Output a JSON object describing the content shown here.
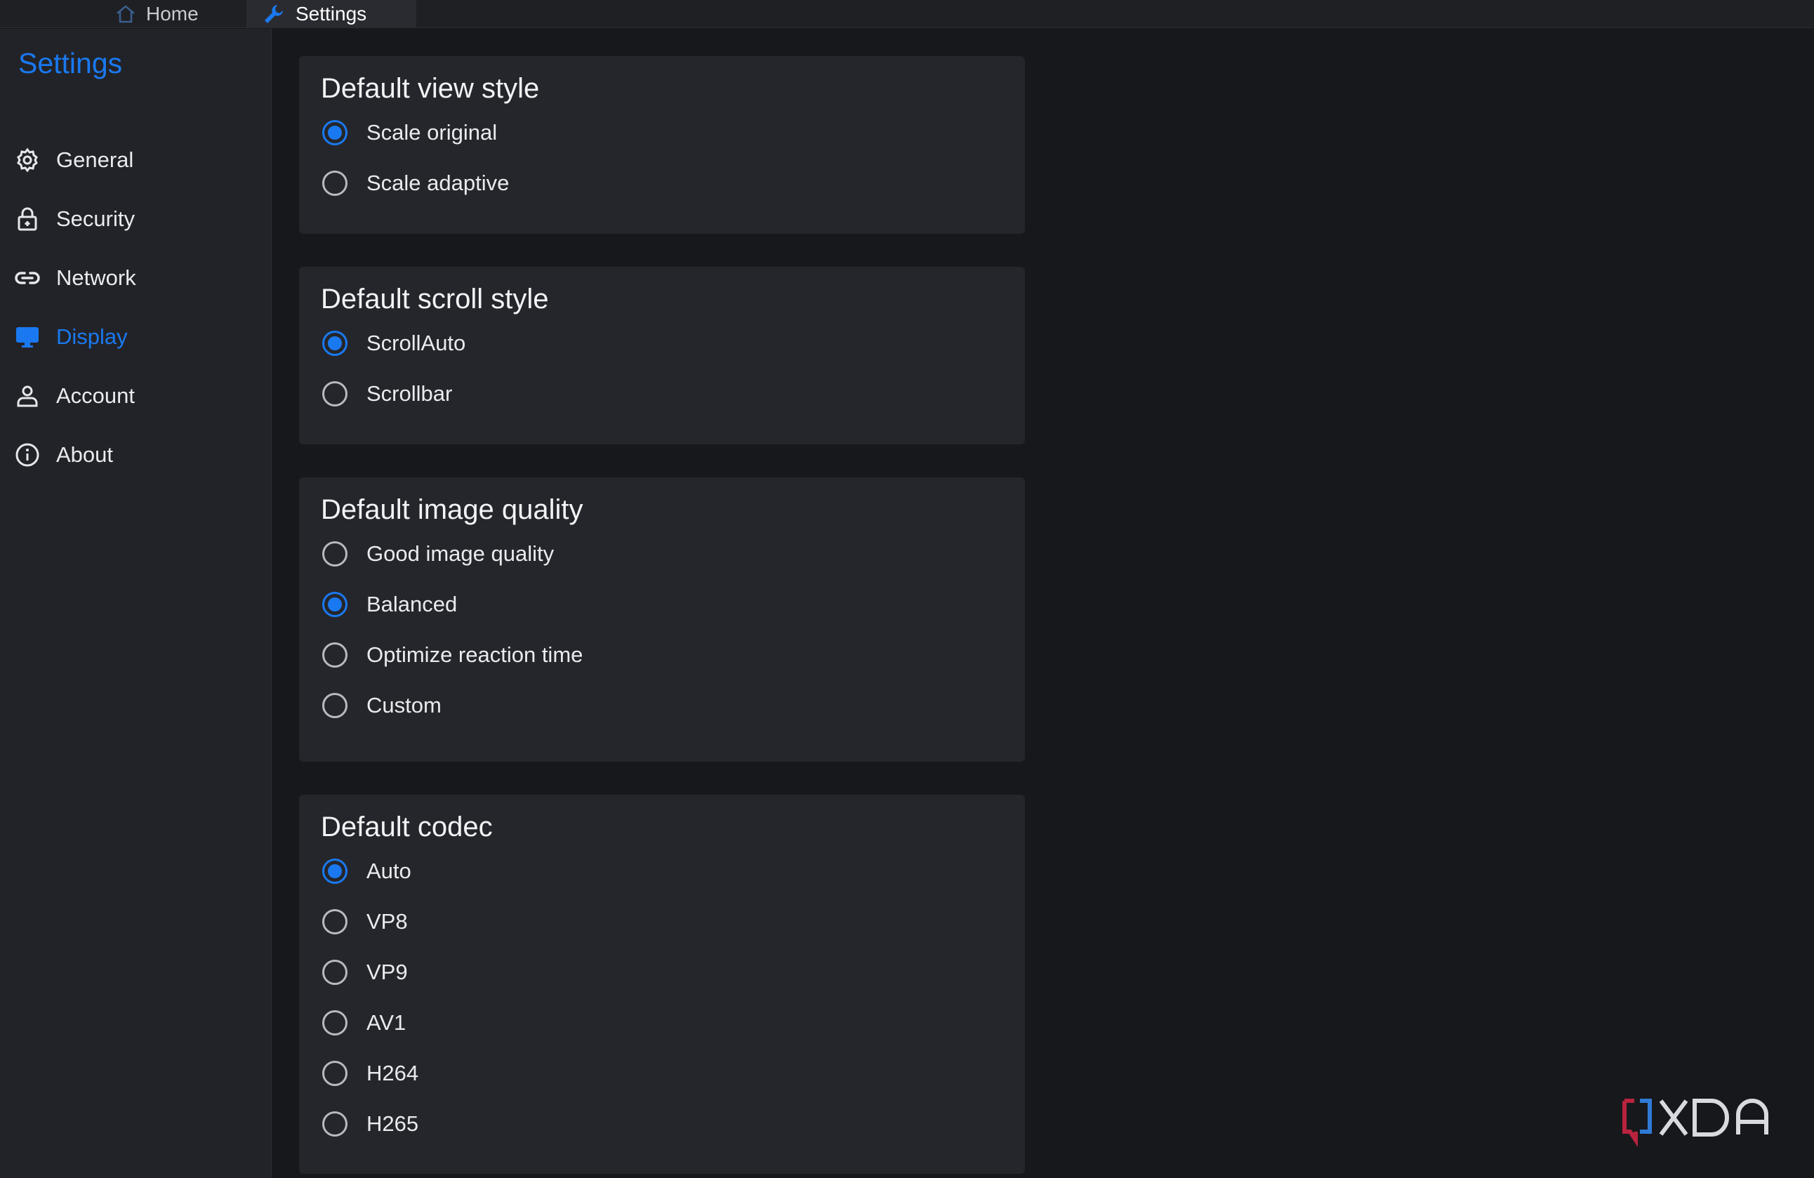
{
  "tabs": [
    {
      "label": "Home",
      "icon": "home-icon"
    },
    {
      "label": "Settings",
      "icon": "wrench-icon"
    }
  ],
  "sidebar": {
    "title": "Settings",
    "items": [
      {
        "label": "General",
        "icon": "gear-icon"
      },
      {
        "label": "Security",
        "icon": "lock-icon"
      },
      {
        "label": "Network",
        "icon": "link-icon"
      },
      {
        "label": "Display",
        "icon": "monitor-icon",
        "active": true
      },
      {
        "label": "Account",
        "icon": "user-icon"
      },
      {
        "label": "About",
        "icon": "info-icon"
      }
    ]
  },
  "sections": [
    {
      "title": "Default view style",
      "options": [
        {
          "label": "Scale original",
          "checked": true
        },
        {
          "label": "Scale adaptive",
          "checked": false
        }
      ]
    },
    {
      "title": "Default scroll style",
      "options": [
        {
          "label": "ScrollAuto",
          "checked": true
        },
        {
          "label": "Scrollbar",
          "checked": false
        }
      ]
    },
    {
      "title": "Default image quality",
      "options": [
        {
          "label": "Good image quality",
          "checked": false
        },
        {
          "label": "Balanced",
          "checked": true
        },
        {
          "label": "Optimize reaction time",
          "checked": false
        },
        {
          "label": "Custom",
          "checked": false
        }
      ]
    },
    {
      "title": "Default codec",
      "options": [
        {
          "label": "Auto",
          "checked": true
        },
        {
          "label": "VP8",
          "checked": false
        },
        {
          "label": "VP9",
          "checked": false
        },
        {
          "label": "AV1",
          "checked": false
        },
        {
          "label": "H264",
          "checked": false
        },
        {
          "label": "H265",
          "checked": false
        }
      ]
    }
  ],
  "watermark": {
    "text": "XDA"
  },
  "colors": {
    "accent": "#1a79f0",
    "background": "#17181c",
    "sidebar": "#222328",
    "card": "#25262b"
  }
}
